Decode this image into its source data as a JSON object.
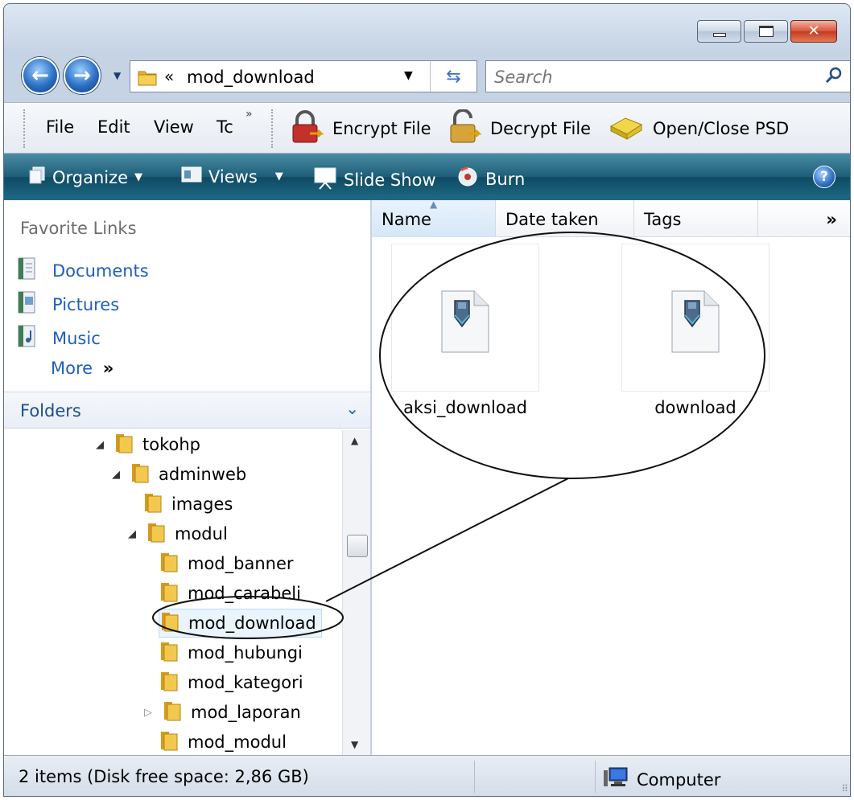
{
  "address": {
    "separator": "«",
    "path": "mod_download"
  },
  "search": {
    "placeholder": "Search"
  },
  "menu": {
    "file": "File",
    "edit": "Edit",
    "view": "View",
    "tools_truncated": "Tc",
    "overflow": "»"
  },
  "tools": {
    "encrypt": "Encrypt File",
    "decrypt": "Decrypt File",
    "open_close": "Open/Close PSD"
  },
  "commands": {
    "organize": "Organize",
    "views": "Views",
    "slideshow": "Slide Show",
    "burn": "Burn",
    "help": "?"
  },
  "favorites": {
    "title": "Favorite Links",
    "items": [
      "Documents",
      "Pictures",
      "Music"
    ],
    "more": "More",
    "more_glyph": "»"
  },
  "folders": {
    "title": "Folders",
    "tree": [
      {
        "label": "tokohp",
        "arrow": "◢"
      },
      {
        "label": "adminweb",
        "arrow": "◢"
      },
      {
        "label": "images",
        "arrow": ""
      },
      {
        "label": "modul",
        "arrow": "◢"
      },
      {
        "label": "mod_banner",
        "arrow": ""
      },
      {
        "label": "mod_carabeli",
        "arrow": ""
      },
      {
        "label": "mod_download",
        "arrow": ""
      },
      {
        "label": "mod_hubungi",
        "arrow": ""
      },
      {
        "label": "mod_kategori",
        "arrow": ""
      },
      {
        "label": "mod_laporan",
        "arrow": "▷"
      },
      {
        "label": "mod_modul",
        "arrow": ""
      }
    ]
  },
  "columns": {
    "name": "Name",
    "date": "Date taken",
    "tags": "Tags",
    "more": "»"
  },
  "files": [
    "aksi_download",
    "download"
  ],
  "status": {
    "items": "2 items (Disk free space: 2,86 GB)",
    "location": "Computer"
  },
  "colors": {
    "link": "#1e5fbf",
    "cmdbar": "#1d5d78",
    "folder": "#e8b22e"
  }
}
